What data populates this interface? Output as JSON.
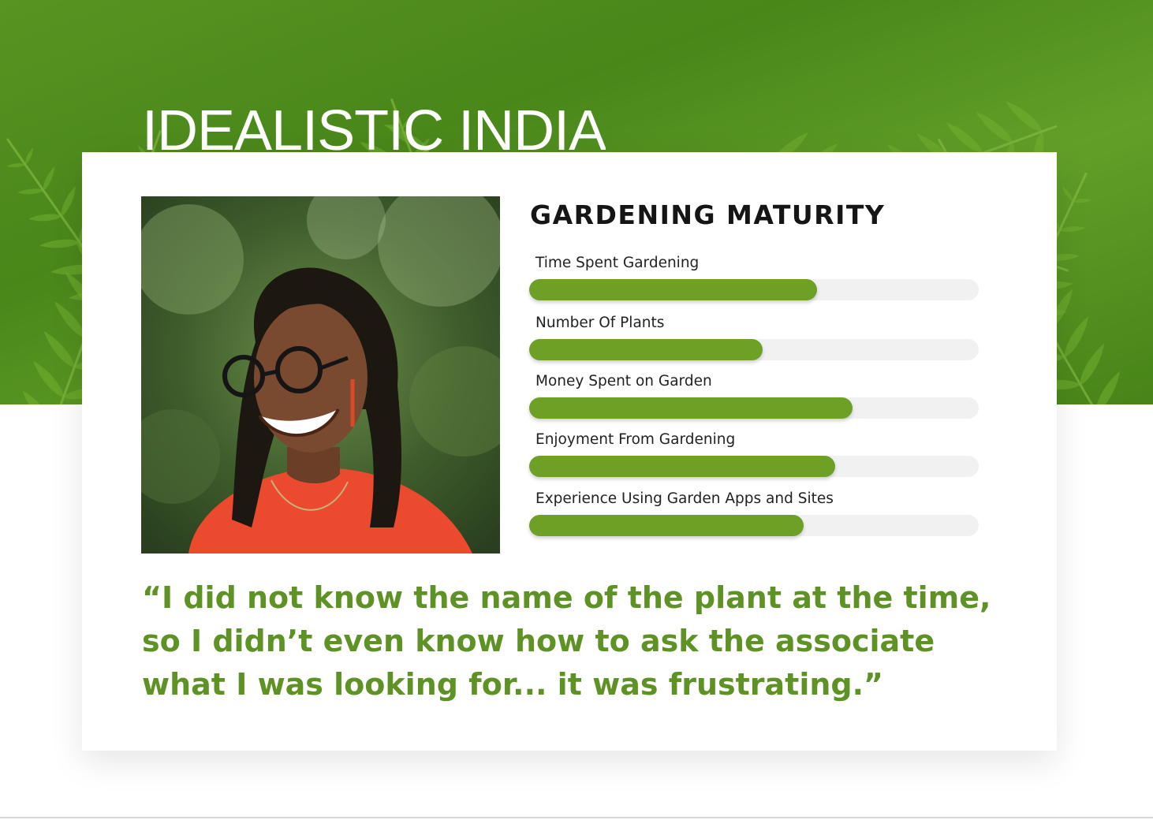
{
  "persona": {
    "name": "IDEALISTIC INDIA"
  },
  "maturity": {
    "title": "GARDENING MATURITY",
    "metrics": [
      {
        "label": "Time Spent Gardening",
        "level": 0.64
      },
      {
        "label": "Number Of Plants",
        "level": 0.52
      },
      {
        "label": "Money Spent on Garden",
        "level": 0.72
      },
      {
        "label": "Enjoyment From Gardening",
        "level": 0.68
      },
      {
        "label": "Experience Using Garden Apps and Sites",
        "level": 0.61
      }
    ]
  },
  "quote": {
    "text": "“I did not know the name of the plant at the time, so I didn’t even know how to ask the associate what I was looking for... it was frustrating.”"
  },
  "colors": {
    "accent_green": "#6da024",
    "quote_green": "#5f9225",
    "track_gray": "#f1f1f1"
  }
}
